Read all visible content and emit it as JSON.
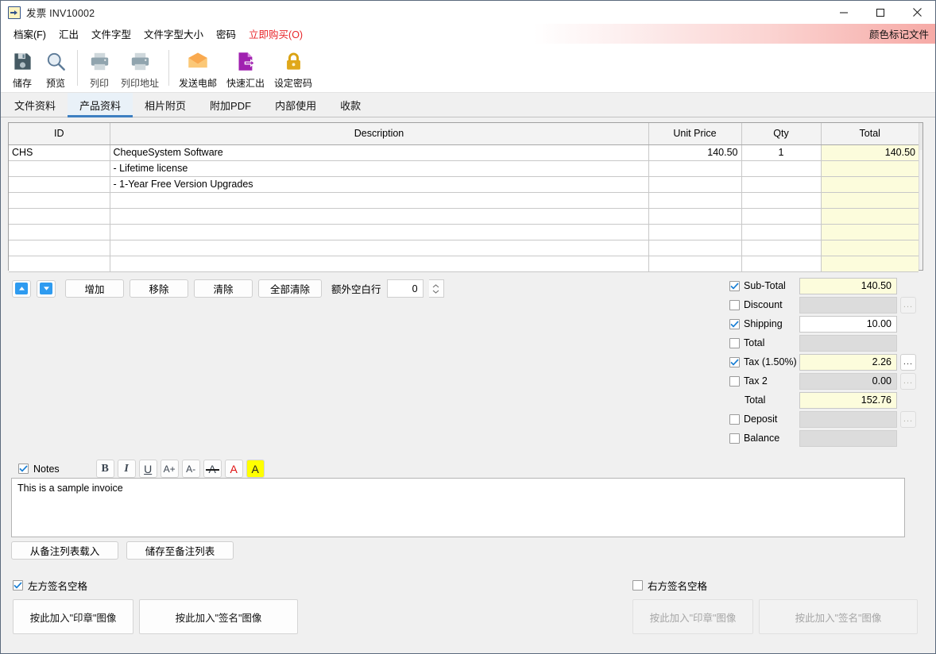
{
  "window": {
    "title": "发票 INV10002",
    "icon": "invoice-export-icon",
    "minimize": "–",
    "maximize": "□",
    "close": "✕"
  },
  "menu": {
    "items": [
      {
        "label": "档案(F)",
        "accel": "F",
        "highlight": false
      },
      {
        "label": "汇出",
        "accel": "",
        "highlight": false
      },
      {
        "label": "文件字型",
        "accel": "",
        "highlight": false
      },
      {
        "label": "文件字型大小",
        "accel": "",
        "highlight": false
      },
      {
        "label": "密码",
        "accel": "",
        "highlight": false
      },
      {
        "label": "立即购买(O)",
        "accel": "O",
        "highlight": true
      }
    ],
    "right_label": "颜色标记文件",
    "buy_color": "#e8262a"
  },
  "toolbar": {
    "buttons": [
      {
        "label": "储存",
        "icon": "save-floppy-icon",
        "disabled": false
      },
      {
        "label": "预览",
        "icon": "magnifier-preview-icon",
        "disabled": false
      },
      {
        "label": "列印",
        "icon": "printer-icon",
        "disabled": true
      },
      {
        "label": "列印地址",
        "icon": "printer-address-icon",
        "disabled": true
      },
      {
        "label": "发送电邮",
        "icon": "envelope-email-icon",
        "disabled": false
      },
      {
        "label": "快速汇出",
        "icon": "document-export-icon",
        "disabled": false
      },
      {
        "label": "设定密码",
        "icon": "lock-password-icon",
        "disabled": false
      }
    ]
  },
  "tabs": [
    {
      "label": "文件资料",
      "active": false
    },
    {
      "label": "产品资料",
      "active": true
    },
    {
      "label": "相片附页",
      "active": false
    },
    {
      "label": "附加PDF",
      "active": false
    },
    {
      "label": "内部使用",
      "active": false
    },
    {
      "label": "收款",
      "active": false
    }
  ],
  "grid": {
    "columns": [
      "ID",
      "Description",
      "Unit Price",
      "Qty",
      "Total"
    ],
    "rows": [
      {
        "id": "CHS",
        "description": "ChequeSystem Software",
        "unit_price": "140.50",
        "qty": "1",
        "total": "140.50"
      },
      {
        "id": "",
        "description": "- Lifetime license",
        "unit_price": "",
        "qty": "",
        "total": ""
      },
      {
        "id": "",
        "description": "- 1-Year Free Version Upgrades",
        "unit_price": "",
        "qty": "",
        "total": ""
      },
      {
        "id": "",
        "description": "",
        "unit_price": "",
        "qty": "",
        "total": ""
      },
      {
        "id": "",
        "description": "",
        "unit_price": "",
        "qty": "",
        "total": ""
      },
      {
        "id": "",
        "description": "",
        "unit_price": "",
        "qty": "",
        "total": ""
      },
      {
        "id": "",
        "description": "",
        "unit_price": "",
        "qty": "",
        "total": ""
      },
      {
        "id": "",
        "description": "",
        "unit_price": "",
        "qty": "",
        "total": ""
      }
    ]
  },
  "row_controls": {
    "move_up": "move-up",
    "move_down": "move-down",
    "add": "增加",
    "remove": "移除",
    "clear": "清除",
    "clear_all": "全部清除",
    "blank_rows_label": "额外空白行",
    "blank_rows_value": "0"
  },
  "totals": [
    {
      "label": "Sub-Total",
      "checked": true,
      "value": "140.50",
      "style": "yellow",
      "dots": "none"
    },
    {
      "label": "Discount",
      "checked": false,
      "value": "",
      "style": "grey",
      "dots": "disabled"
    },
    {
      "label": "Shipping",
      "checked": true,
      "value": "10.00",
      "style": "white",
      "dots": "none"
    },
    {
      "label": "Total",
      "checked": false,
      "value": "",
      "style": "grey",
      "dots": "none"
    },
    {
      "label": "Tax (1.50%)",
      "checked": true,
      "value": "2.26",
      "style": "yellow",
      "dots": "enabled"
    },
    {
      "label": "Tax 2",
      "checked": false,
      "value": "0.00",
      "style": "grey",
      "dots": "disabled"
    },
    {
      "label": "Total",
      "checked": null,
      "value": "152.76",
      "style": "yellow",
      "dots": "none"
    },
    {
      "label": "Deposit",
      "checked": false,
      "value": "",
      "style": "grey",
      "dots": "disabled"
    },
    {
      "label": "Balance",
      "checked": false,
      "value": "",
      "style": "grey",
      "dots": "none"
    }
  ],
  "notes": {
    "checkbox_label": "Notes",
    "checked": true,
    "text": "This is a sample invoice",
    "format_buttons": [
      {
        "name": "bold",
        "glyph": "B"
      },
      {
        "name": "italic",
        "glyph": "I"
      },
      {
        "name": "underline",
        "glyph": "U"
      },
      {
        "name": "font-increase",
        "glyph": "A+"
      },
      {
        "name": "font-decrease",
        "glyph": "A-"
      },
      {
        "name": "strikethrough",
        "glyph": "A"
      },
      {
        "name": "font-color",
        "glyph": "A"
      },
      {
        "name": "highlight-color",
        "glyph": "A"
      }
    ],
    "load_button": "从备注列表载入",
    "save_button": "储存至备注列表"
  },
  "signatures": {
    "left": {
      "checkbox_label": "左方签名空格",
      "checked": true,
      "chop_button": "按此加入\"印章\"图像",
      "sign_button": "按此加入\"签名\"图像",
      "disabled": false
    },
    "right": {
      "checkbox_label": "右方签名空格",
      "checked": false,
      "chop_button": "按此加入\"印章\"图像",
      "sign_button": "按此加入\"签名\"图像",
      "disabled": true
    }
  },
  "colors": {
    "accent_blue": "#3d7fc1",
    "yellow_field": "#fcfcdc",
    "grey_field": "#dcdcdc",
    "buy_red": "#e8262a",
    "banner_pink": "#f6aaa6"
  }
}
